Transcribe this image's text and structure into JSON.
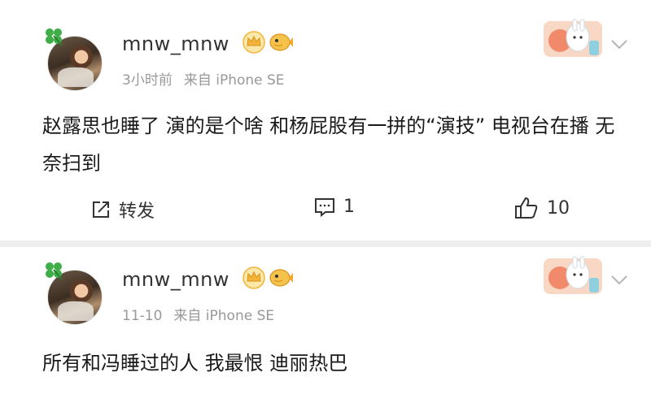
{
  "posts": [
    {
      "username": "mnw_mnw",
      "time": "3小时前",
      "source": "来自 iPhone SE",
      "content": "赵露思也睡了 演的是个啥 和杨屁股有一拼的“演技” 电视台在播 无奈扫到",
      "actions": {
        "repost_label": "转发",
        "comment_count": "1",
        "like_count": "10"
      }
    },
    {
      "username": "mnw_mnw",
      "time": "11-10",
      "source": "来自 iPhone SE",
      "content": "所有和冯睡过的人 我最恨 迪丽热巴"
    }
  ],
  "colors": {
    "text": "#1a1a1a",
    "meta": "#999999",
    "divider": "#eeeeee",
    "badge_gold": "#f2b53a"
  },
  "icons": [
    "clover-icon",
    "crown-badge-icon",
    "fish-badge-icon",
    "chevron-down-icon",
    "repost-icon",
    "comment-icon",
    "like-icon"
  ]
}
